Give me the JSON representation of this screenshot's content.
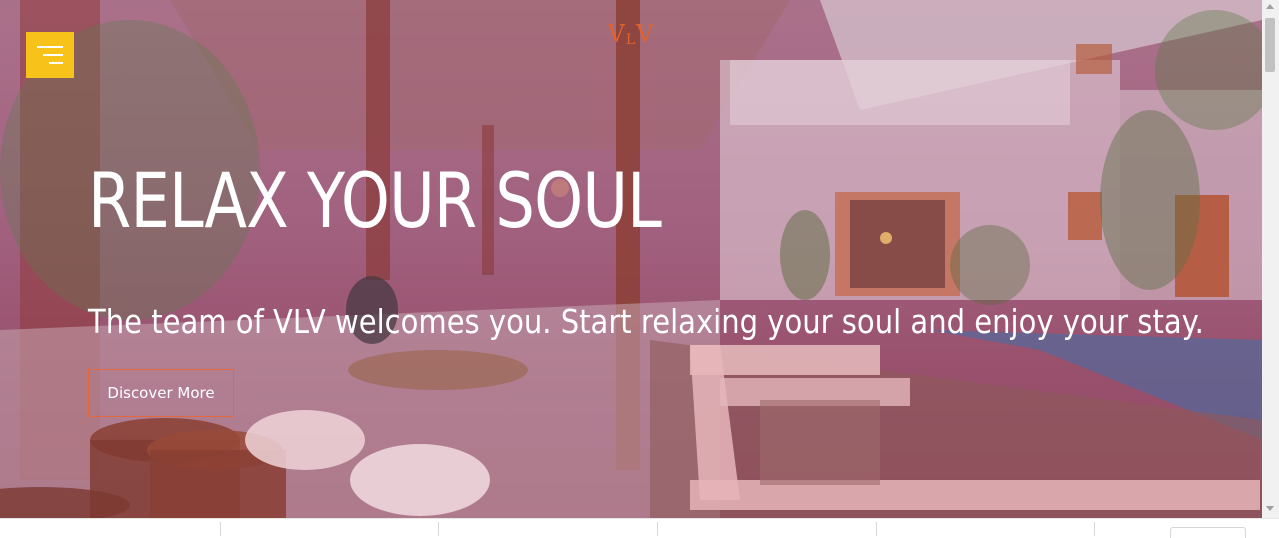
{
  "header": {
    "logo": {
      "big_left": "V",
      "small_mid": "L",
      "big_right": "V"
    },
    "menu_icon": "hamburger-menu-icon",
    "menu_color": "#f7c21a"
  },
  "hero": {
    "headline": "RELAX YOUR SOUL",
    "tagline": "The team of VLV welcomes you. Start relaxing your soul and enjoy your stay.",
    "cta_label": "Discover More",
    "overlay_color": "#962850",
    "accent_color": "#e4683c"
  }
}
